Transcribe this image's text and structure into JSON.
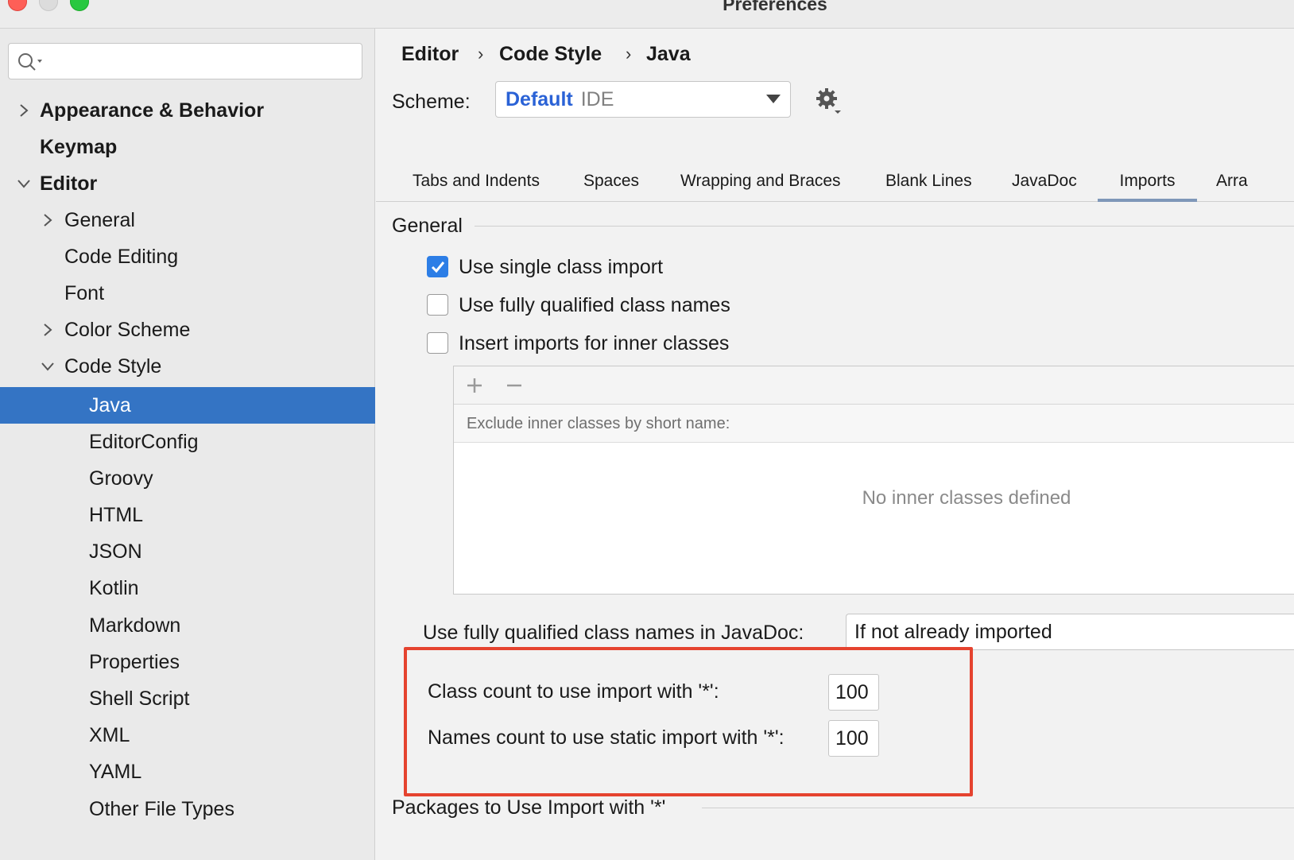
{
  "window": {
    "title": "Preferences"
  },
  "sidebar": {
    "search": {
      "value": "",
      "placeholder": ""
    },
    "items": [
      {
        "label": "Appearance & Behavior"
      },
      {
        "label": "Keymap"
      },
      {
        "label": "Editor"
      },
      {
        "label": "General"
      },
      {
        "label": "Code Editing"
      },
      {
        "label": "Font"
      },
      {
        "label": "Color Scheme"
      },
      {
        "label": "Code Style"
      },
      {
        "label": "Java"
      },
      {
        "label": "EditorConfig"
      },
      {
        "label": "Groovy"
      },
      {
        "label": "HTML"
      },
      {
        "label": "JSON"
      },
      {
        "label": "Kotlin"
      },
      {
        "label": "Markdown"
      },
      {
        "label": "Properties"
      },
      {
        "label": "Shell Script"
      },
      {
        "label": "XML"
      },
      {
        "label": "YAML"
      },
      {
        "label": "Other File Types"
      }
    ],
    "selected": "Java"
  },
  "breadcrumb": {
    "items": [
      "Editor",
      "Code Style",
      "Java"
    ],
    "separator": "›"
  },
  "scheme": {
    "label": "Scheme:",
    "name": "Default",
    "kind": "IDE"
  },
  "tabs": [
    {
      "label": "Tabs and Indents"
    },
    {
      "label": "Spaces"
    },
    {
      "label": "Wrapping and Braces"
    },
    {
      "label": "Blank Lines"
    },
    {
      "label": "JavaDoc"
    },
    {
      "label": "Imports"
    },
    {
      "label": "Arra"
    }
  ],
  "active_tab": "Imports",
  "general": {
    "title": "General",
    "options": [
      {
        "label": "Use single class import",
        "checked": true
      },
      {
        "label": "Use fully qualified class names",
        "checked": false
      },
      {
        "label": "Insert imports for inner classes",
        "checked": false
      }
    ],
    "inner_classes": {
      "header": "Exclude inner classes by short name:",
      "empty_text": "No inner classes defined"
    },
    "javadoc_fq": {
      "label": "Use fully qualified class names in JavaDoc:",
      "value": "If not already imported"
    },
    "class_count": {
      "label": "Class count to use import with '*':",
      "value": "100"
    },
    "names_count": {
      "label": "Names count to use static import with '*':",
      "value": "100"
    }
  },
  "packages": {
    "title": "Packages to Use Import with '*'"
  },
  "colors": {
    "selection": "#3474c4",
    "highlight_border": "#e5432f",
    "scheme_accent": "#2a62d6"
  },
  "icons": [
    "search-icon",
    "chevron-right-icon",
    "chevron-down-icon",
    "gear-icon",
    "dropdown-arrow-icon",
    "plus-icon",
    "minus-icon",
    "checkmark-icon"
  ]
}
